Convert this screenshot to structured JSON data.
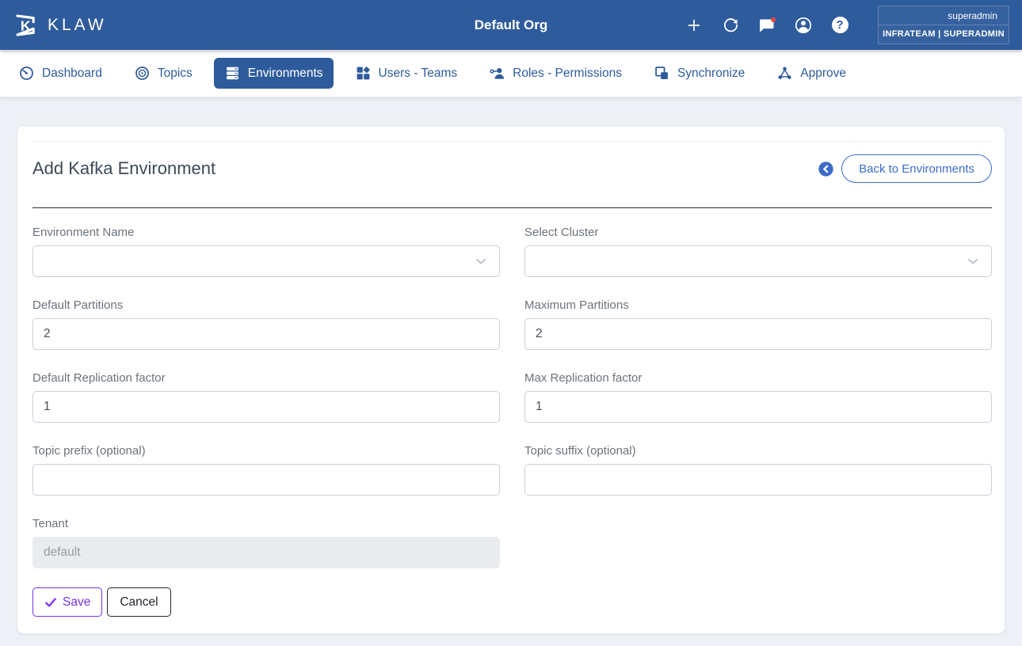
{
  "header": {
    "logo_text": "KLAW",
    "org_title": "Default Org",
    "user_name": "superadmin",
    "user_team_role": "INFRATEAM | SUPERADMIN",
    "help_glyph": "?"
  },
  "nav": {
    "items": [
      {
        "label": "Dashboard",
        "icon": "dashboard-icon",
        "active": false
      },
      {
        "label": "Topics",
        "icon": "topics-icon",
        "active": false
      },
      {
        "label": "Environments",
        "icon": "environments-icon",
        "active": true
      },
      {
        "label": "Users - Teams",
        "icon": "users-teams-icon",
        "active": false
      },
      {
        "label": "Roles - Permissions",
        "icon": "roles-permissions-icon",
        "active": false
      },
      {
        "label": "Synchronize",
        "icon": "synchronize-icon",
        "active": false
      },
      {
        "label": "Approve",
        "icon": "approve-icon",
        "active": false
      }
    ]
  },
  "page": {
    "title": "Add Kafka Environment",
    "back_button_label": "Back to Environments"
  },
  "form": {
    "fields": [
      {
        "label": "Environment Name",
        "type": "select",
        "value": ""
      },
      {
        "label": "Select Cluster",
        "type": "select",
        "value": ""
      },
      {
        "label": "Default Partitions",
        "type": "text",
        "value": "2"
      },
      {
        "label": "Maximum Partitions",
        "type": "text",
        "value": "2"
      },
      {
        "label": "Default Replication factor",
        "type": "text",
        "value": "1"
      },
      {
        "label": "Max Replication factor",
        "type": "text",
        "value": "1"
      },
      {
        "label": "Topic prefix (optional)",
        "type": "text",
        "value": ""
      },
      {
        "label": "Topic suffix (optional)",
        "type": "text",
        "value": ""
      },
      {
        "label": "Tenant",
        "type": "text",
        "value": "default",
        "disabled": true
      }
    ],
    "save_label": "Save",
    "cancel_label": "Cancel"
  },
  "colors": {
    "header_bg": "#2E5B9C",
    "nav_link_blue": "#2E5B9C",
    "active_tab_bg": "#2E5B9C",
    "back_button_blue": "#3D6CC8",
    "save_purple": "#7632EB",
    "cancel_border": "#24292F",
    "notification_red": "#F4433C",
    "disabled_input_bg": "#E9ECEF",
    "page_bg": "#EDF1F6"
  }
}
